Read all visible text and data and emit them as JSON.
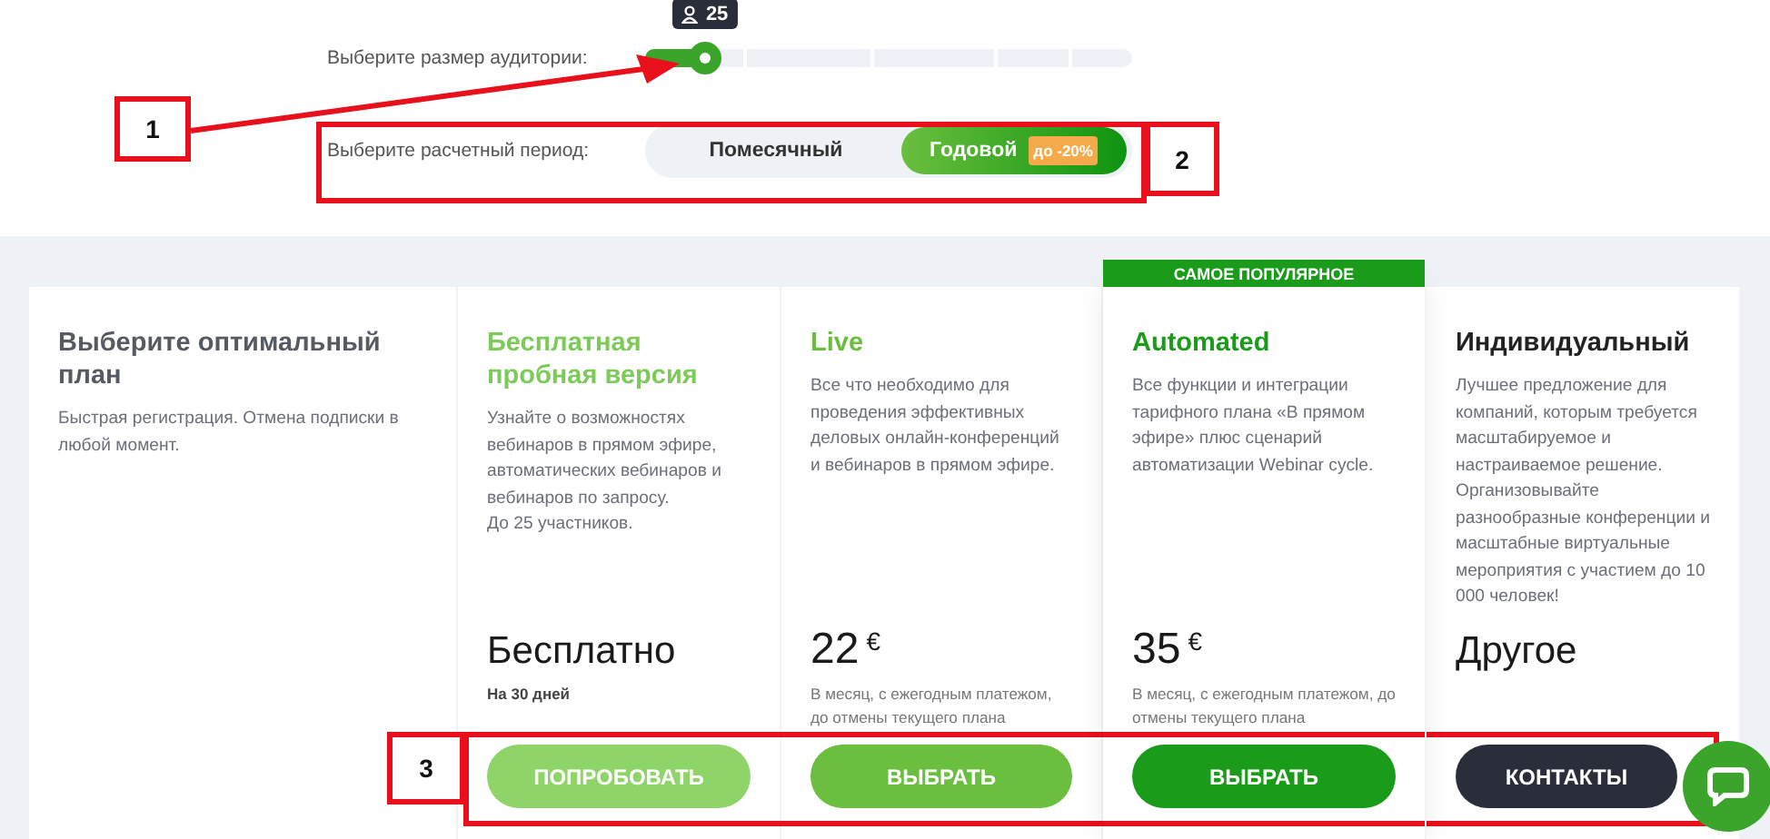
{
  "audience": {
    "label": "Выберите размер аудитории:",
    "level": 0.08,
    "tooltip": "25"
  },
  "period": {
    "label": "Выберите расчетный период:",
    "options": [
      {
        "label": "Помесячный",
        "selected": false
      },
      {
        "label": "Годовой",
        "selected": true,
        "badge": "до -20%"
      }
    ]
  },
  "plans": [
    {
      "kind": "intro",
      "title": "Выберите оптимальный план",
      "description": "Быстрая регистрация. Отмена подписки в любой момент."
    },
    {
      "kind": "plan",
      "title": "Бесплатная пробная версия",
      "color": "#7dc95a",
      "description": "Узнайте о возможностях вебинаров в прямом эфире, автоматических вебинаров и вебинаров по запросу.\nДо 25 участников.",
      "price": "Бесплатно",
      "note": "На 30 дней",
      "button": {
        "label": "ПОПРОБОВАТЬ",
        "color": "#8fd468"
      }
    },
    {
      "kind": "plan",
      "title": "Live",
      "color": "#6abf3e",
      "description": "Все что необходимо для проведения эффективных деловых онлайн-конференций и вебинаров в прямом эфире.",
      "price": "22",
      "currency": "€",
      "note": "В месяц, с ежегодным платежом, до отмены текущего плана",
      "button": {
        "label": "ВЫБРАТЬ",
        "color": "#6abf3e"
      }
    },
    {
      "kind": "plan",
      "title": "Automated",
      "color": "#1a9c1a",
      "badge": "САМОЕ ПОПУЛЯРНОЕ",
      "description": "Все функции и интеграции тарифного плана «В прямом эфире» плюс сценарий автоматизации Webinar cycle.",
      "price": "35",
      "currency": "€",
      "note": "В месяц, с ежегодным платежом, до отмены текущего плана",
      "button": {
        "label": "ВЫБРАТЬ",
        "color": "#1a9c1a"
      }
    },
    {
      "kind": "plan",
      "title": "Индивидуальный",
      "color": "#222222",
      "description": "Лучшее предложение для компаний, которым требуется масштабируемое и настраиваемое решение. Организовывайте разнообразные конференции и масштабные виртуальные мероприятия с участием до 10 000 человек!",
      "price": "Другое",
      "button": {
        "label": "КОНТАКТЫ",
        "color": "#2a2d3a"
      }
    }
  ],
  "annotations": [
    {
      "label": "1"
    },
    {
      "label": "2"
    },
    {
      "label": "3"
    }
  ]
}
